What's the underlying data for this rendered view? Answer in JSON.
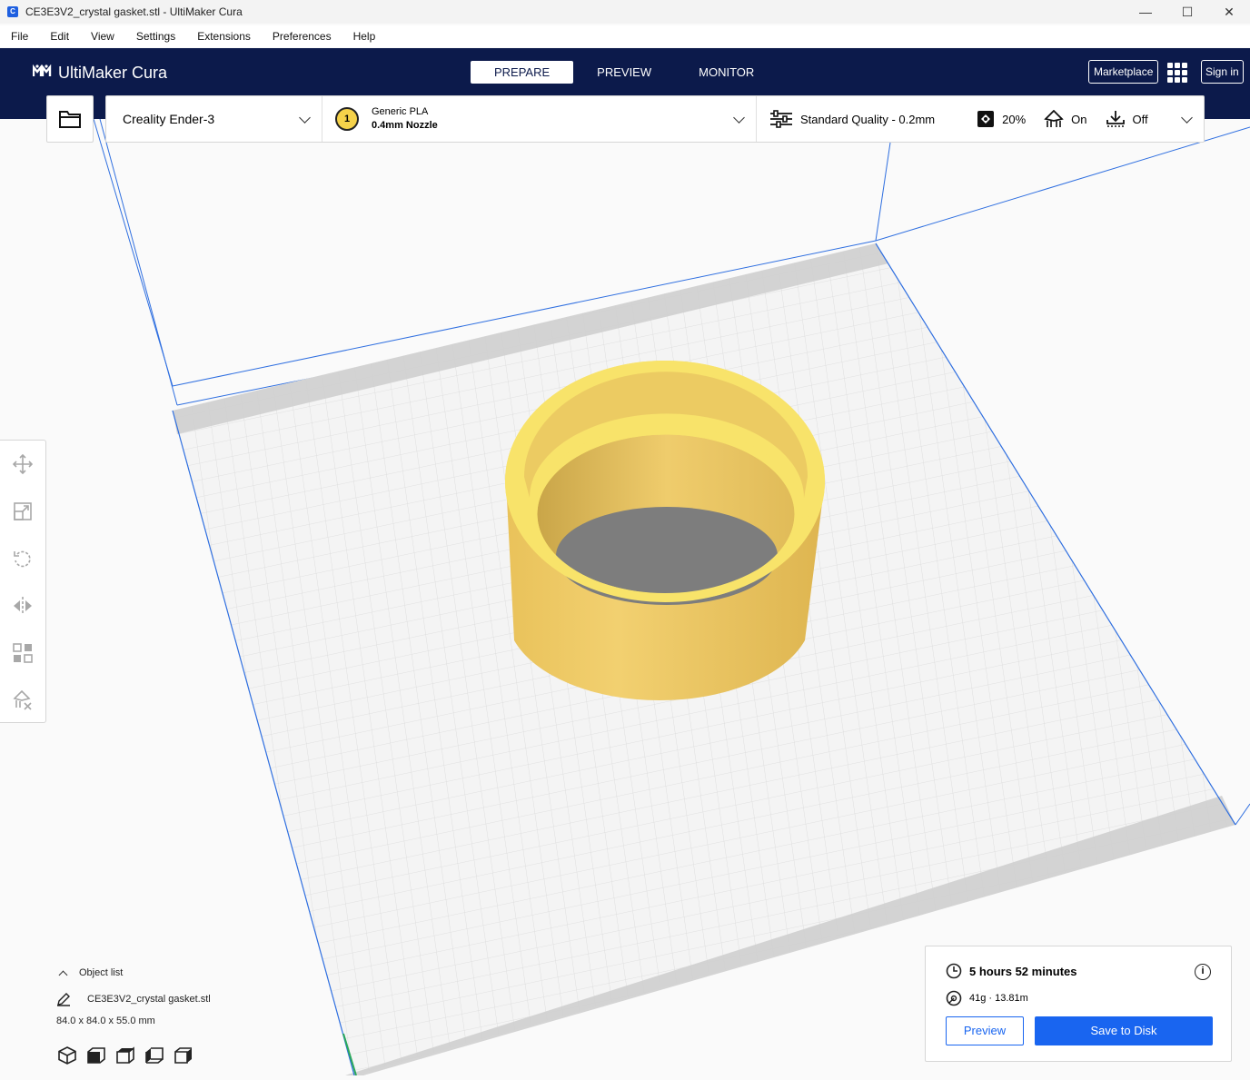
{
  "window": {
    "title": "CE3E3V2_crystal gasket.stl - UltiMaker Cura",
    "app_icon": "C",
    "minimize_icon": "minimize-icon",
    "maximize_icon": "maximize-icon",
    "close_icon": "close-icon"
  },
  "menu": [
    "File",
    "Edit",
    "View",
    "Settings",
    "Extensions",
    "Preferences",
    "Help"
  ],
  "header": {
    "logo": "UltiMaker Cura",
    "logo_mark": "♠♠",
    "stages": [
      "PREPARE",
      "PREVIEW",
      "MONITOR"
    ],
    "active_stage": "PREPARE",
    "marketplace": "Marketplace",
    "sign_in": "Sign in"
  },
  "config": {
    "printer": "Creality Ender-3",
    "extruder_number": "1",
    "material": "Generic PLA",
    "nozzle": "0.4mm Nozzle",
    "quality": "Standard Quality - 0.2mm",
    "infill": "20%",
    "support": "On",
    "adhesion": "Off"
  },
  "tools": [
    "move-tool-icon",
    "scale-tool-icon",
    "rotate-tool-icon",
    "mirror-tool-icon",
    "per-model-settings-icon",
    "support-blocker-icon"
  ],
  "object_list": {
    "toggle_label": "Object list",
    "object_name": "CE3E3V2_crystal gasket.stl",
    "dimensions": "84.0 x 84.0 x 55.0 mm"
  },
  "print": {
    "time": "5 hours 52 minutes",
    "material_usage": "41g · 13.81m",
    "preview_button": "Preview",
    "save_button": "Save to Disk"
  },
  "colors": {
    "header_bg": "#0c1a4b",
    "accent_blue": "#1965f0",
    "model_yellow": "#f5d467",
    "build_plate": "#f3f3f3"
  }
}
